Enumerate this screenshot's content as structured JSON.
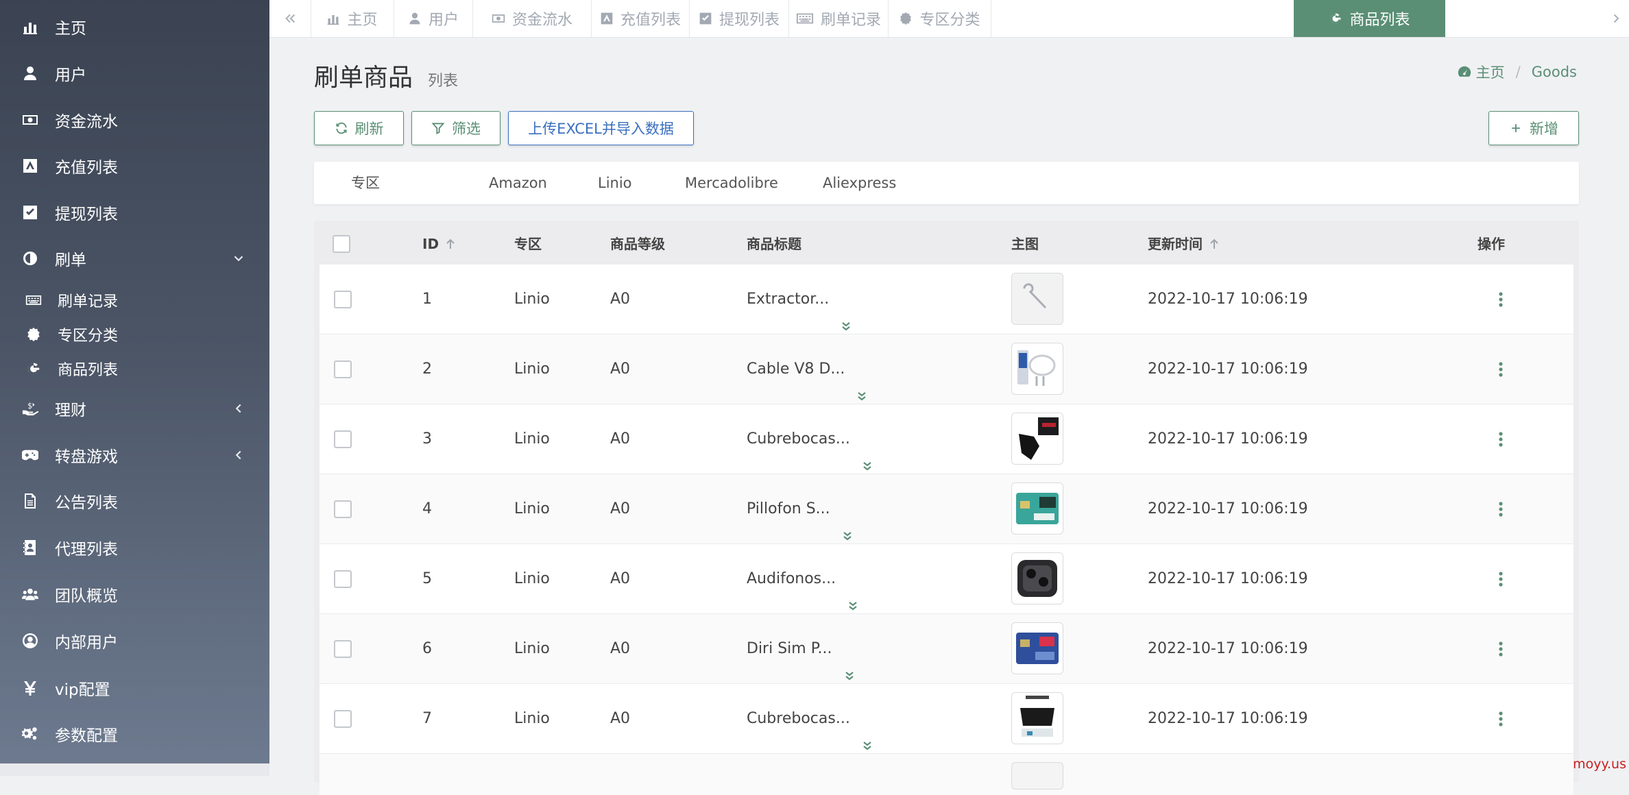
{
  "sidebar": {
    "items": [
      {
        "label": "主页",
        "icon": "bar-chart-icon"
      },
      {
        "label": "用户",
        "icon": "user-icon"
      },
      {
        "label": "资金流水",
        "icon": "money-icon"
      },
      {
        "label": "充值列表",
        "icon": "amazon-icon"
      },
      {
        "label": "提现列表",
        "icon": "check-square-icon"
      },
      {
        "label": "刷单",
        "icon": "contrast-icon",
        "expanded": true
      },
      {
        "label": "理财",
        "icon": "cash-hand-icon",
        "expanded": false
      },
      {
        "label": "转盘游戏",
        "icon": "gamepad-icon",
        "expanded": false
      },
      {
        "label": "公告列表",
        "icon": "file-icon"
      },
      {
        "label": "代理列表",
        "icon": "contact-book-icon"
      },
      {
        "label": "团队概览",
        "icon": "users-icon"
      },
      {
        "label": "内部用户",
        "icon": "user-circle-icon"
      },
      {
        "label": "vip配置",
        "icon": "yen-icon"
      },
      {
        "label": "参数配置",
        "icon": "cogs-icon"
      }
    ],
    "sub_items": [
      {
        "label": "刷单记录",
        "icon": "keyboard-icon"
      },
      {
        "label": "专区分类",
        "icon": "certificate-icon"
      },
      {
        "label": "商品列表",
        "icon": "google-icon"
      }
    ]
  },
  "tabs": [
    {
      "label": "主页",
      "icon": "bar-chart-icon"
    },
    {
      "label": "用户",
      "icon": "user-icon"
    },
    {
      "label": "资金流水",
      "icon": "money-icon"
    },
    {
      "label": "充值列表",
      "icon": "amazon-icon"
    },
    {
      "label": "提现列表",
      "icon": "check-square-icon"
    },
    {
      "label": "刷单记录",
      "icon": "keyboard-icon"
    },
    {
      "label": "专区分类",
      "icon": "certificate-icon"
    },
    {
      "label": "商品列表",
      "icon": "google-icon",
      "active": true
    }
  ],
  "page": {
    "title": "刷单商品",
    "subtitle": "列表"
  },
  "breadcrumb": {
    "home": "主页",
    "current": "Goods"
  },
  "toolbar": {
    "refresh": "刷新",
    "filter": "筛选",
    "upload": "上传EXCEL并导入数据",
    "add": "新增"
  },
  "filter_tabs": [
    "专区",
    "Amazon",
    "Linio",
    "Mercadolibre",
    "Aliexpress"
  ],
  "table": {
    "columns": [
      "ID",
      "专区",
      "商品等级",
      "商品标题",
      "主图",
      "更新时间",
      "操作"
    ],
    "rows": [
      {
        "id": "1",
        "zone": "Linio",
        "level": "A0",
        "title": "Extractor...",
        "image": "sim-eject-pin",
        "updated": "2022-10-17 10:06:19"
      },
      {
        "id": "2",
        "zone": "Linio",
        "level": "A0",
        "title": "Cable V8 D...",
        "image": "usb-cable",
        "updated": "2022-10-17 10:06:19"
      },
      {
        "id": "3",
        "zone": "Linio",
        "level": "A0",
        "title": "Cubrebocas...",
        "image": "black-mask",
        "updated": "2022-10-17 10:06:19"
      },
      {
        "id": "4",
        "zone": "Linio",
        "level": "A0",
        "title": "Pillofon S...",
        "image": "sim-card-green",
        "updated": "2022-10-17 10:06:19"
      },
      {
        "id": "5",
        "zone": "Linio",
        "level": "A0",
        "title": "Audifonos...",
        "image": "earbuds-case",
        "updated": "2022-10-17 10:06:19"
      },
      {
        "id": "6",
        "zone": "Linio",
        "level": "A0",
        "title": "Diri Sim P...",
        "image": "sim-card-blue",
        "updated": "2022-10-17 10:06:19"
      },
      {
        "id": "7",
        "zone": "Linio",
        "level": "A0",
        "title": "Cubrebocas...",
        "image": "mask-pack",
        "updated": "2022-10-17 10:06:19"
      }
    ]
  },
  "watermark": "moyy.us",
  "colors": {
    "accent": "#5a8f75",
    "link_blue": "#3a6fc0",
    "sidebar_top": "#3b4352",
    "sidebar_bottom": "#6e7b90"
  }
}
